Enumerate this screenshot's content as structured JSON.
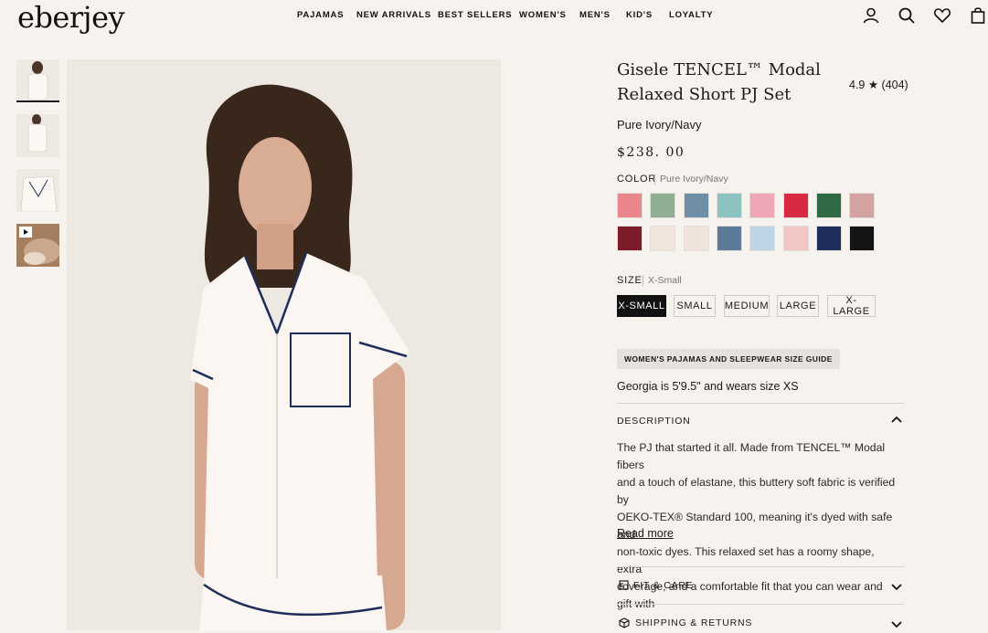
{
  "brand": {
    "logo": "eberjey"
  },
  "nav": [
    "PAJAMAS",
    "NEW ARRIVALS",
    "BEST SELLERS",
    "WOMEN'S",
    "MEN'S",
    "KID'S",
    "LOYALTY"
  ],
  "header_icons": [
    "account-icon",
    "search-icon",
    "heart-icon",
    "bag-icon"
  ],
  "product": {
    "title_line1": "Gisele TENCEL™ Modal",
    "title_line2": "Relaxed Short PJ Set",
    "rating": "4.9 ★ (404)",
    "variant_name": "Pure Ivory/Navy",
    "price": "$238. 00"
  },
  "color": {
    "label": "COLOR",
    "selected": "Pure Ivory/Navy",
    "swatches": [
      "#e8868c",
      "#8fae94",
      "#6f8fa6",
      "#8cc3c0",
      "#efa6b5",
      "#d92a44",
      "#2f6a45",
      "#d4a2a0",
      "#7d1d2b",
      "#f0e6dc",
      "#efe3db",
      "#5d7b99",
      "#bfd4e6",
      "#f2c6c4",
      "#1f2d5c",
      "#141414"
    ]
  },
  "size": {
    "label": "SIZE",
    "selected": "X-Small",
    "options": [
      "X-SMALL",
      "SMALL",
      "MEDIUM",
      "LARGE",
      "X-LARGE"
    ]
  },
  "size_guide": "WOMEN'S PAJAMAS AND SLEEPWEAR SIZE GUIDE",
  "model_note": "Georgia is 5'9.5\" and wears size XS",
  "description": {
    "heading": "DESCRIPTION",
    "lines": [
      "The PJ that started it all. Made from TENCEL™ Modal fibers",
      "and a touch of elastane, this buttery soft fabric is verified by",
      "OEKO-TEX® Standard 100, meaning it's dyed with safe and",
      "non-toxic dyes. This relaxed set has a roomy shape, extra",
      "coverage, and a comfortable fit that you can wear and gift with"
    ],
    "read_more": "Read more"
  },
  "fit_care": "FIT & CARE",
  "shipping": "SHIPPING & RETURNS"
}
